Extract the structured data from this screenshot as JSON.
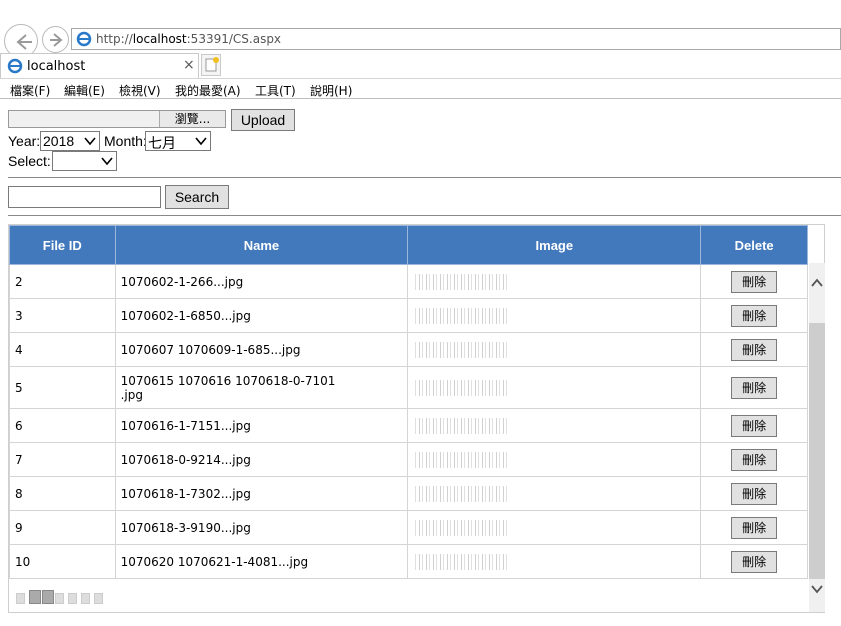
{
  "browser": {
    "url_prefix": "http://",
    "url_host": "localhost",
    "url_rest": ":53391/CS.aspx",
    "tab_title": "localhost",
    "tab_close": "×",
    "menu": [
      "檔案(F)",
      "編輯(E)",
      "檢視(V)",
      "我的最愛(A)",
      "工具(T)",
      "說明(H)"
    ]
  },
  "form": {
    "browse_label": "瀏覽...",
    "upload_label": "Upload",
    "year_label": "Year:",
    "year_value": "2018",
    "month_label": "Month:",
    "month_value": "七月",
    "select_label": "Select:",
    "select_value": "",
    "search_value": "",
    "search_label": "Search"
  },
  "grid": {
    "headers": [
      "File ID",
      "Name",
      "Image",
      "Delete"
    ],
    "delete_label": "刪除",
    "rows": [
      {
        "id": "2",
        "name": "1070602-1-266...jpg"
      },
      {
        "id": "3",
        "name": "1070602-1-6850...jpg"
      },
      {
        "id": "4",
        "name": "1070607 1070609-1-685...jpg"
      },
      {
        "id": "5",
        "name": "1070615 1070616 1070618-0-7101",
        "name2": ".jpg"
      },
      {
        "id": "6",
        "name": "1070616-1-7151...jpg"
      },
      {
        "id": "7",
        "name": "1070618-0-9214...jpg"
      },
      {
        "id": "8",
        "name": "1070618-1-7302...jpg"
      },
      {
        "id": "9",
        "name": "1070618-3-9190...jpg"
      },
      {
        "id": "10",
        "name": "1070620 1070621-1-4081...jpg"
      }
    ]
  },
  "colors": {
    "header_bg": "#4279bd",
    "header_text": "#ffffff"
  }
}
